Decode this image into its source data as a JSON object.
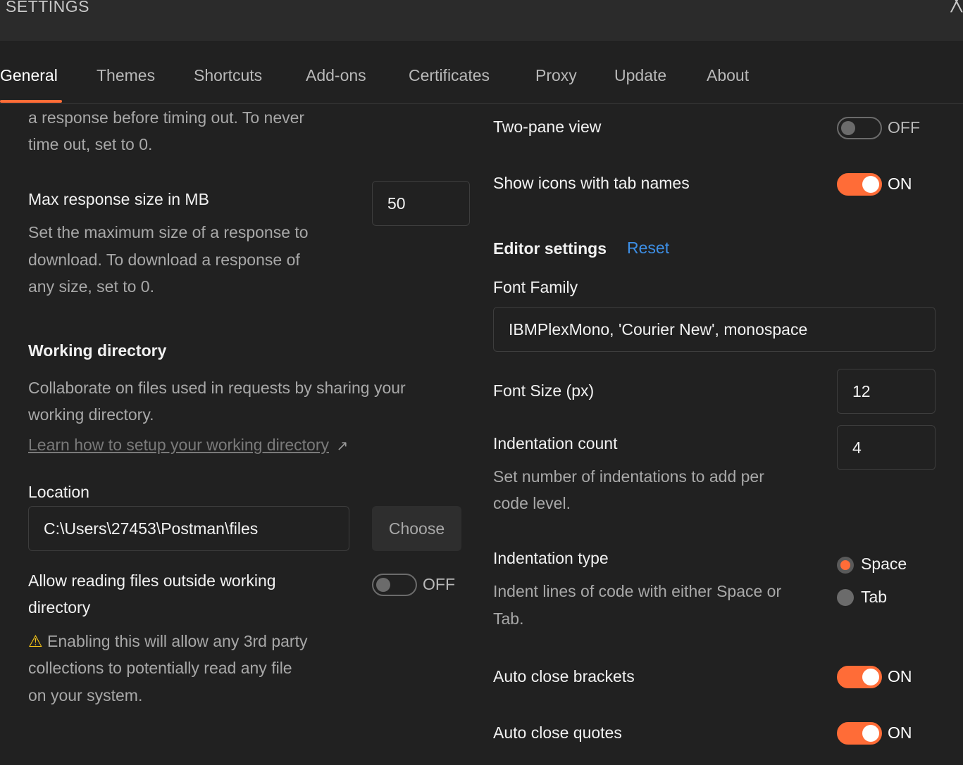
{
  "window": {
    "title": "SETTINGS",
    "close_glyph": "╳"
  },
  "tabs": [
    {
      "label": "General"
    },
    {
      "label": "Themes"
    },
    {
      "label": "Shortcuts"
    },
    {
      "label": "Add-ons"
    },
    {
      "label": "Certificates"
    },
    {
      "label": "Proxy"
    },
    {
      "label": "Update"
    },
    {
      "label": "About"
    }
  ],
  "left": {
    "timeout_desc_1": "a response before timing out. To never",
    "timeout_desc_2": "time out, set to 0.",
    "max_response": {
      "label": "Max response size in MB",
      "value": "50",
      "desc_1": "Set the maximum size of a response to",
      "desc_2": "download. To download a response of",
      "desc_3": "any size, set to 0."
    },
    "working_dir": {
      "heading": "Working directory",
      "desc_1": "Collaborate on files used in requests by sharing your",
      "desc_2": "working directory.",
      "link": "Learn how to setup your working directory",
      "link_arrow": "↗"
    },
    "location": {
      "label": "Location",
      "value": "C:\\Users\\27453\\Postman\\files",
      "button": "Choose"
    },
    "allow_outside": {
      "label_1": "Allow reading files outside working",
      "label_2": "directory",
      "state": "OFF",
      "warning_icon": "⚠",
      "warn_1": "Enabling this will allow any 3rd party",
      "warn_2": "collections to potentially read any file",
      "warn_3": "on your system."
    }
  },
  "right": {
    "two_pane": {
      "label": "Two-pane view",
      "state": "OFF"
    },
    "show_icons": {
      "label": "Show icons with tab names",
      "state": "ON"
    },
    "editor": {
      "heading": "Editor settings",
      "reset": "Reset"
    },
    "font_family": {
      "label": "Font Family",
      "value": "IBMPlexMono, 'Courier New', monospace"
    },
    "font_size": {
      "label": "Font Size (px)",
      "value": "12"
    },
    "indent_count": {
      "label": "Indentation count",
      "value": "4",
      "desc_1": "Set number of indentations to add per",
      "desc_2": "code level."
    },
    "indent_type": {
      "label": "Indentation type",
      "desc_1": "Indent lines of code with either Space or",
      "desc_2": "Tab.",
      "options": [
        "Space",
        "Tab"
      ],
      "selected": "Space"
    },
    "auto_brackets": {
      "label": "Auto close brackets",
      "state": "ON"
    },
    "auto_quotes": {
      "label": "Auto close quotes",
      "state": "ON"
    }
  },
  "colors": {
    "accent": "#ff6c37",
    "link": "#3d8fe6",
    "background": "#212121"
  }
}
